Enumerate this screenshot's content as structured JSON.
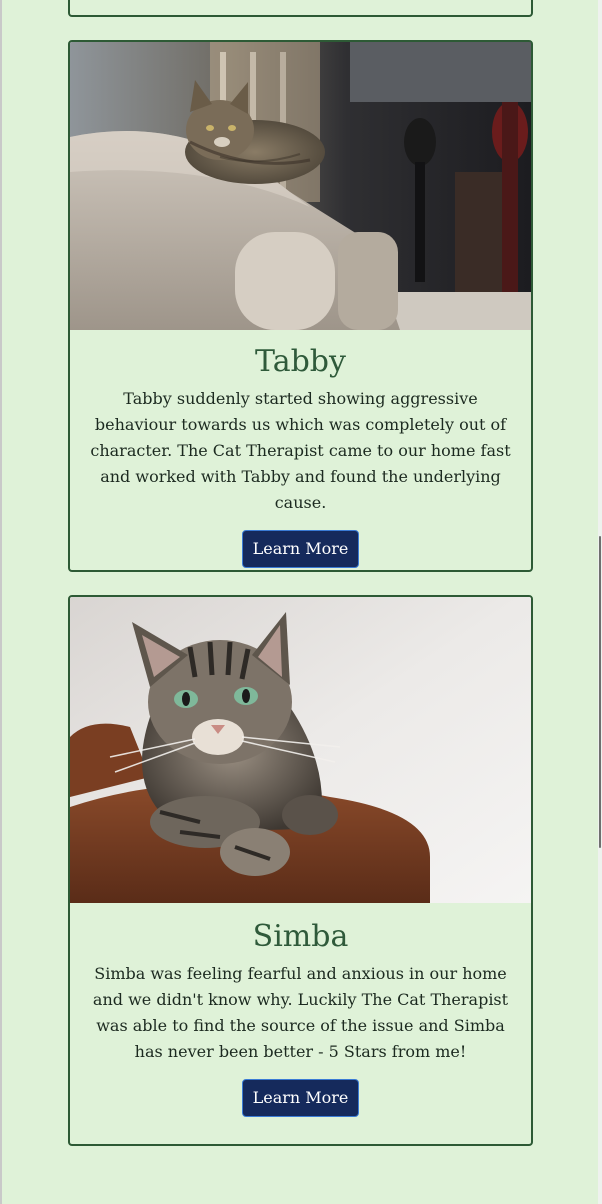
{
  "cards": [
    {
      "title": "Tabby",
      "text": "Tabby suddenly started showing aggressive behaviour towards us which was completely out of character. The Cat Therapist came to our home fast and worked with Tabby and found the underlying cause.",
      "button_label": "Learn More"
    },
    {
      "title": "Simba",
      "text": "Simba was feeling fearful and anxious in our home and we didn't know why. Luckily The Cat Therapist was able to find the source of the issue and Simba has never been better - 5 Stars from me!",
      "button_label": "Learn More"
    }
  ],
  "colors": {
    "page_background": "#dff2d8",
    "card_border": "#2d5a35",
    "title_color": "#2f5a3a",
    "button_background": "#152a5c",
    "button_border": "#3a7bd5"
  }
}
